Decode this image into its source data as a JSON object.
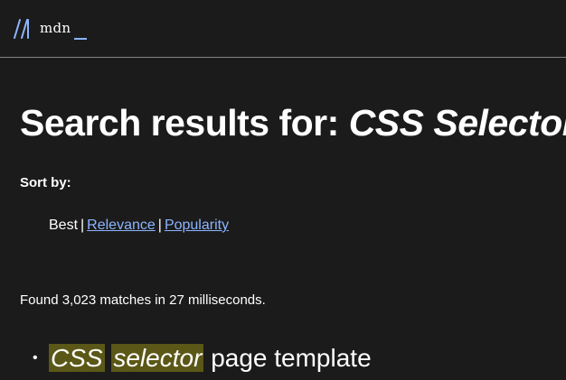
{
  "header": {
    "logo_text": "mdn",
    "accent_color": "#8cb4ff"
  },
  "main": {
    "title_prefix": "Search results for:",
    "query": "CSS Selector",
    "sort_label": "Sort by:",
    "sort_options": {
      "best": "Best",
      "relevance": "Relevance",
      "popularity": "Popularity"
    },
    "found_text": "Found 3,023 matches in 27 milliseconds.",
    "results": [
      {
        "highlight_1": "CSS",
        "highlight_2": "selector",
        "rest": "page template"
      }
    ]
  },
  "colors": {
    "background": "#1b1b1b",
    "text": "#ffffff",
    "link": "#8cb4ff",
    "highlight": "#5b5717",
    "divider": "#858585"
  }
}
